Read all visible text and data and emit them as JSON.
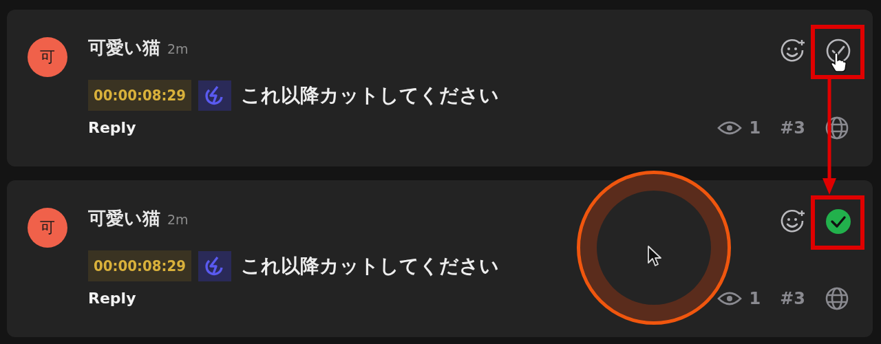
{
  "comments": [
    {
      "avatar": "可",
      "author": "可愛い猫",
      "time": "2m",
      "timecode": "00:00:08:29",
      "text": "これ以降カットしてください",
      "reply": "Reply",
      "views": "1",
      "number": "#3",
      "resolved": false,
      "highlighted": true,
      "hand_cursor": true,
      "pointer_cursor": false,
      "click_ring": false
    },
    {
      "avatar": "可",
      "author": "可愛い猫",
      "time": "2m",
      "timecode": "00:00:08:29",
      "text": "これ以降カットしてください",
      "reply": "Reply",
      "views": "1",
      "number": "#3",
      "resolved": true,
      "highlighted": true,
      "hand_cursor": false,
      "pointer_cursor": true,
      "click_ring": true
    }
  ],
  "annotation_arrow": true
}
